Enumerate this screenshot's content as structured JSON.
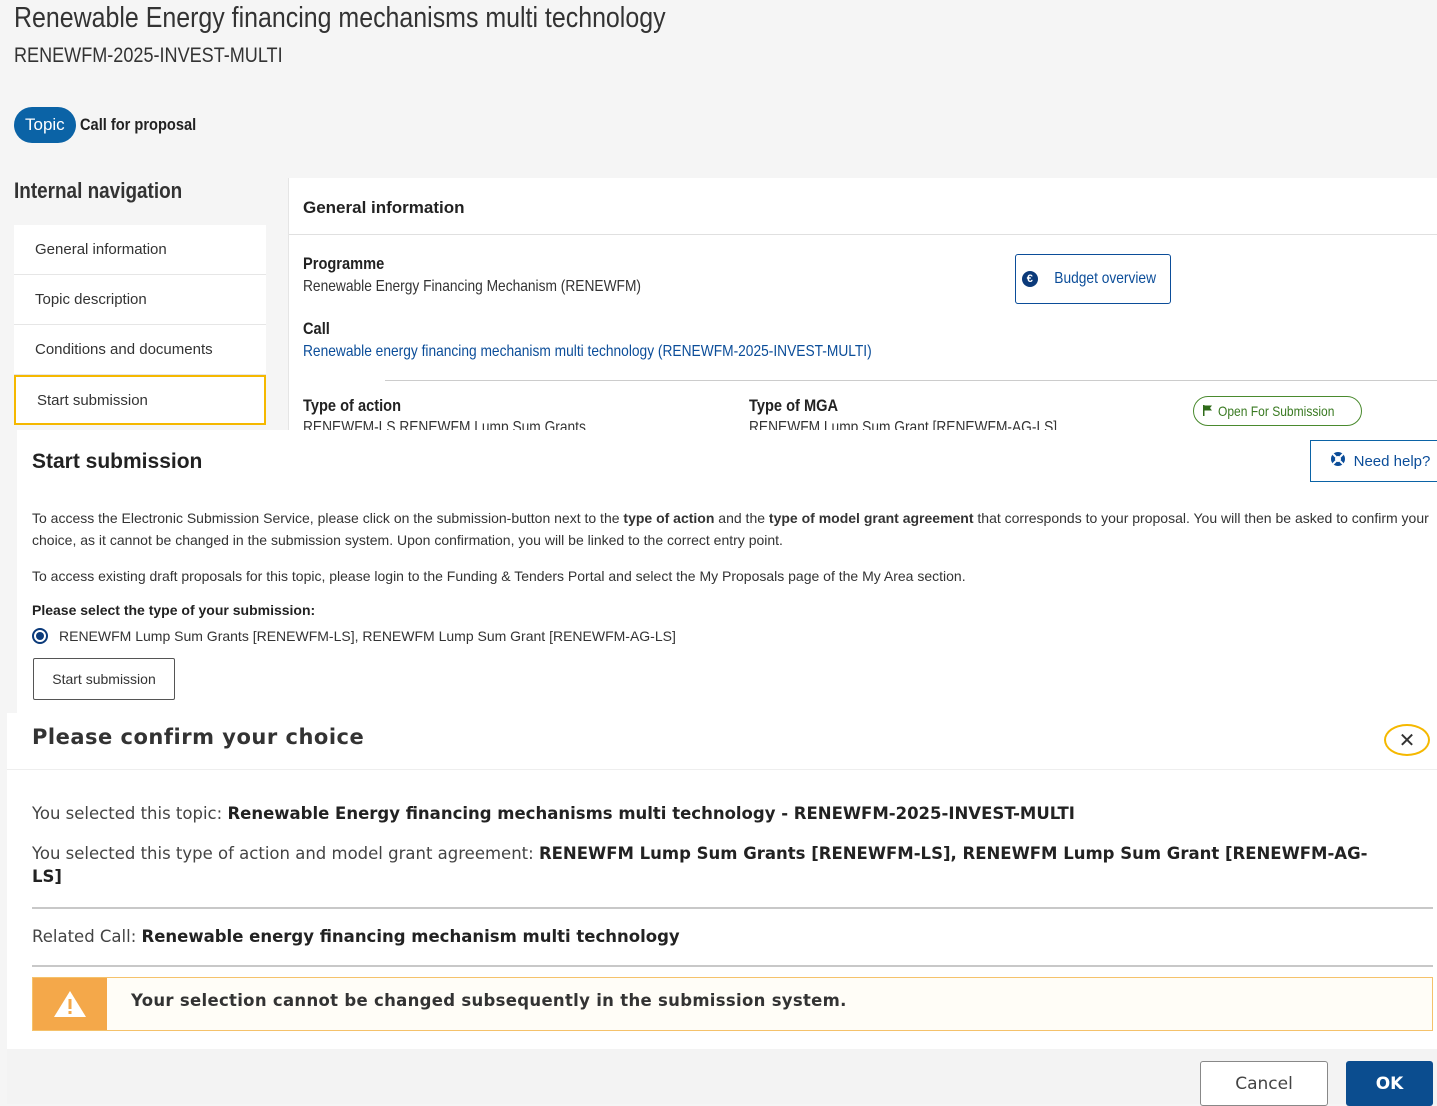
{
  "header": {
    "title": "Renewable Energy financing mechanisms multi technology",
    "identifier": "RENEWFM-2025-INVEST-MULTI",
    "tag": "Topic",
    "tag_text": "Call for proposal"
  },
  "nav": {
    "title": "Internal navigation",
    "items": [
      {
        "label": "General information"
      },
      {
        "label": "Topic description"
      },
      {
        "label": "Conditions and documents"
      },
      {
        "label": "Start submission"
      }
    ]
  },
  "general": {
    "heading": "General information",
    "programme_label": "Programme",
    "programme_value": "Renewable Energy Financing Mechanism (RENEWFM)",
    "budget_button": "Budget overview",
    "call_label": "Call",
    "call_link": "Renewable energy financing mechanism multi technology (RENEWFM-2025-INVEST-MULTI)",
    "type_action_label": "Type of action",
    "type_action_value": "RENEWFM-LS RENEWFM Lump Sum Grants",
    "type_mga_label": "Type of MGA",
    "type_mga_value": "RENEWFM Lump Sum Grant [RENEWFM-AG-LS]",
    "status": "Open For Submission"
  },
  "submission": {
    "title": "Start submission",
    "help_button": "Need help?",
    "para1_a": "To access the Electronic Submission Service, please click on the submission-button next to the ",
    "para1_b": "type of action",
    "para1_c": " and the ",
    "para1_d": "type of model grant agreement",
    "para1_e": " that corresponds to your proposal. You will then be asked to confirm your choice, as it cannot be changed in the submission system. Upon confirmation, you will be linked to the correct entry point.",
    "para2": "To access existing draft proposals for this topic, please login to the Funding & Tenders Portal and select the My Proposals page of the My Area section.",
    "question": "Please select the type of your submission:",
    "option": "RENEWFM Lump Sum Grants [RENEWFM-LS], RENEWFM Lump Sum Grant [RENEWFM-AG-LS]",
    "button": "Start submission"
  },
  "dialog": {
    "title": "Please confirm your choice",
    "topic_prefix": "You selected this topic: ",
    "topic_value": "Renewable Energy financing mechanisms multi technology - RENEWFM-2025-INVEST-MULTI",
    "type_prefix": "You selected this type of action and model grant agreement: ",
    "type_value": "RENEWFM Lump Sum Grants [RENEWFM-LS], RENEWFM Lump Sum Grant [RENEWFM-AG-LS]",
    "call_prefix": "Related Call: ",
    "call_value": "Renewable energy financing mechanism multi technology",
    "warning": "Your selection cannot be changed subsequently in the submission system.",
    "cancel": "Cancel",
    "ok": "OK"
  },
  "colors": {
    "primary": "#0b4d8f",
    "focus_outline": "#f5b800",
    "warning_bg": "#f4a84a",
    "status_green": "#3a7a22"
  }
}
